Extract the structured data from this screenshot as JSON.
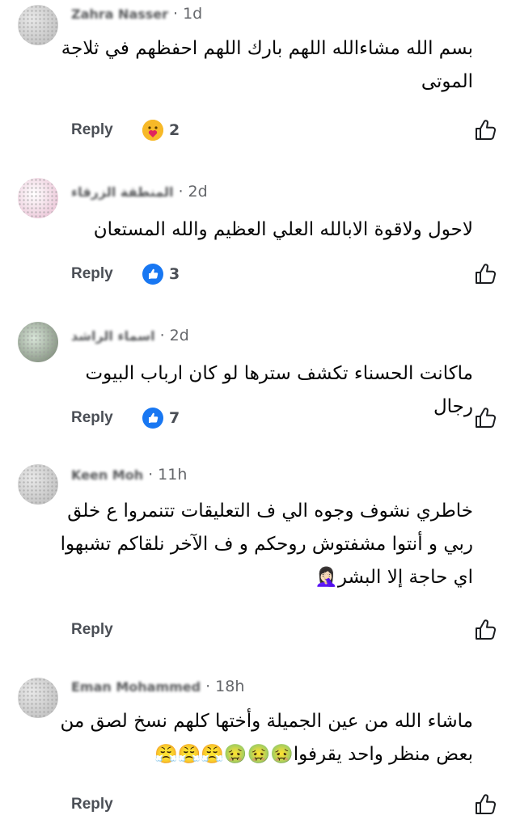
{
  "comments": [
    {
      "name": "Zahra Nasser",
      "time": "1d",
      "lines": [
        "بسم الله مشاءالله اللهم بارك اللهم احفظهم في ثلاجة",
        "الموتى"
      ],
      "reply_label": "Reply",
      "reaction": {
        "type": "care",
        "count": "2"
      }
    },
    {
      "name": "المنطقة الزرقاء",
      "time": "2d",
      "lines": [
        "لاحول ولاقوة الابالله العلي العظيم والله المستعان"
      ],
      "reply_label": "Reply",
      "reaction": {
        "type": "like",
        "count": "3"
      }
    },
    {
      "name": "اسماء الراشد",
      "time": "2d",
      "lines": [
        "ماكانت الحسناء تكشف سترها لو كان ارباب البيوت رجال"
      ],
      "reply_label": "Reply",
      "reaction": {
        "type": "like",
        "count": "7"
      }
    },
    {
      "name": "Keen Moh",
      "time": "11h",
      "lines": [
        "خاطري نشوف وجوه الي ف التعليقات تتنمروا ع خلق",
        "ربي و أنتوا مشفتوش روحكم و ف الآخر نلقاكم تشبهوا",
        "اي حاجة إلا البشر🤦🏻‍♀️"
      ],
      "reply_label": "Reply",
      "reaction": null
    },
    {
      "name": "Eman Mohammed",
      "time": "18h",
      "lines": [
        "ماشاء الله من عين الجميلة وأختها كلهم نسخ لصق من",
        "بعض منظر واحد يقرفوا🤢🤢🤢😤😤😤"
      ],
      "reply_label": "Reply",
      "reaction": null
    }
  ],
  "icons": {
    "like_button": "thumbs-up-outline",
    "like_reaction": "thumbs-up",
    "care_reaction": "care-hug"
  },
  "colors": {
    "like_blue": "#1877f2",
    "care_yellow": "#f7b928",
    "meta_gray": "#65676b"
  }
}
